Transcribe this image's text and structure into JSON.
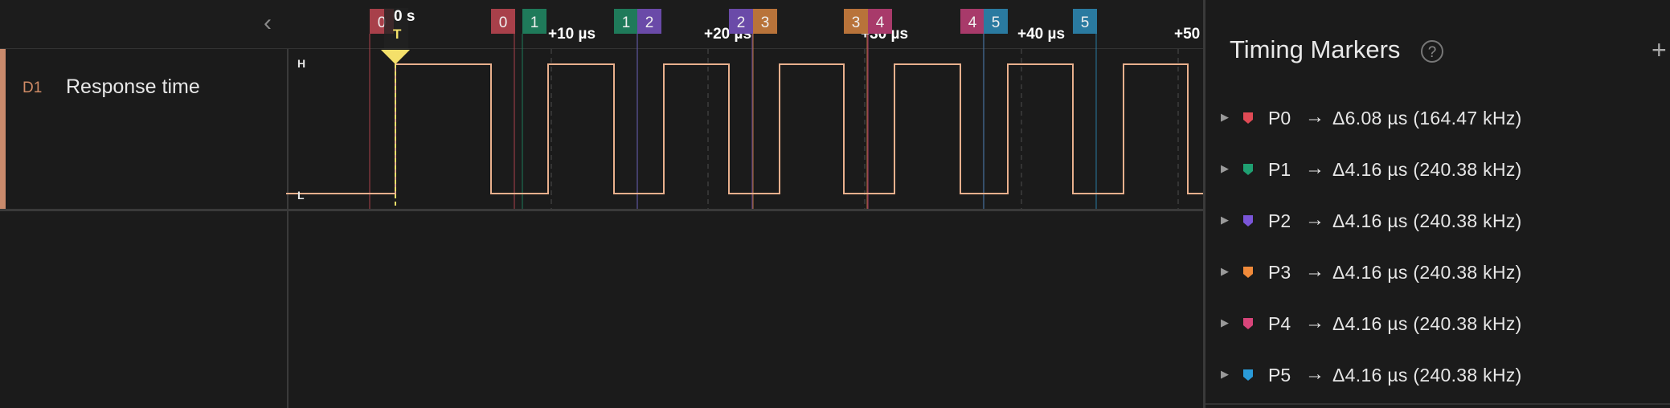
{
  "channel": {
    "name": "D1",
    "label": "Response time",
    "color": "#c98a6c"
  },
  "levels": {
    "high": "H",
    "low": "L"
  },
  "trigger": {
    "label": "0 s",
    "symbol": "T",
    "color": "#f4e06a"
  },
  "time_labels": [
    "+10 µs",
    "+20 µs",
    "+30 µs",
    "+40 µs",
    "+50"
  ],
  "marker_flags": [
    {
      "text": "0",
      "color": "#a8404a"
    },
    {
      "text": "0",
      "color": "#a8404a"
    },
    {
      "text": "1",
      "color": "#1f7a5a"
    },
    {
      "text": "1",
      "color": "#1f7a5a"
    },
    {
      "text": "2",
      "color": "#6a4aa8"
    },
    {
      "text": "2",
      "color": "#6a4aa8"
    },
    {
      "text": "3",
      "color": "#b8733a"
    },
    {
      "text": "3",
      "color": "#b8733a"
    },
    {
      "text": "4",
      "color": "#a83a6a"
    },
    {
      "text": "4",
      "color": "#a83a6a"
    },
    {
      "text": "5",
      "color": "#2a7aa0"
    },
    {
      "text": "5",
      "color": "#2a7aa0"
    }
  ],
  "panel": {
    "title": "Timing Markers",
    "help_icon": "?",
    "add_icon": "+",
    "markers": [
      {
        "name": "P0",
        "arrow": "→",
        "value": "Δ6.08 µs (164.47 kHz)",
        "color": "#e04a55"
      },
      {
        "name": "P1",
        "arrow": "→",
        "value": "Δ4.16 µs (240.38 kHz)",
        "color": "#1fa072"
      },
      {
        "name": "P2",
        "arrow": "→",
        "value": "Δ4.16 µs (240.38 kHz)",
        "color": "#7a55d8"
      },
      {
        "name": "P3",
        "arrow": "→",
        "value": "Δ4.16 µs (240.38 kHz)",
        "color": "#f08a3a"
      },
      {
        "name": "P4",
        "arrow": "→",
        "value": "Δ4.16 µs (240.38 kHz)",
        "color": "#d8457a"
      },
      {
        "name": "P5",
        "arrow": "→",
        "value": "Δ4.16 µs (240.38 kHz)",
        "color": "#2a9ad8"
      }
    ]
  },
  "icons": {
    "collapse": "chevron-left-icon",
    "expand": "triangle-right-icon",
    "pin": "marker-pin-icon"
  }
}
